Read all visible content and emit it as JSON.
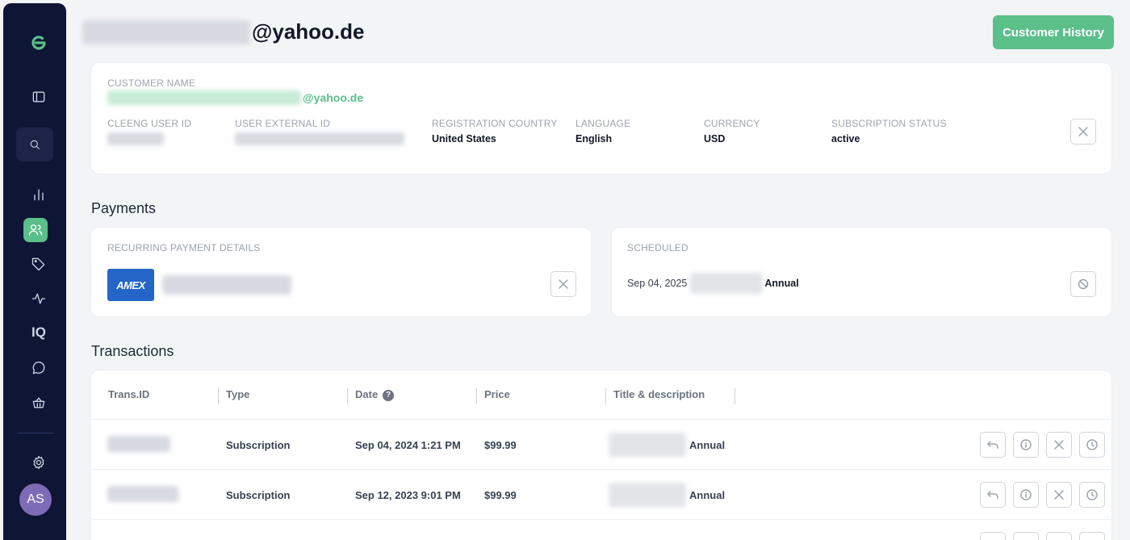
{
  "sidebar": {
    "logo": "green-e-logo",
    "items": [
      {
        "name": "panel-icon"
      },
      {
        "name": "search-icon"
      },
      {
        "name": "analytics-icon"
      },
      {
        "name": "customers-icon"
      },
      {
        "name": "tag-icon"
      },
      {
        "name": "activity-icon"
      },
      {
        "name": "iq-icon",
        "label": "IQ"
      },
      {
        "name": "chat-icon"
      },
      {
        "name": "basket-icon"
      },
      {
        "name": "settings-icon"
      }
    ],
    "avatar_initials": "AS"
  },
  "header": {
    "email_domain": "@yahoo.de",
    "history_button": "Customer History"
  },
  "customer": {
    "name_label": "CUSTOMER NAME",
    "name_domain": "@yahoo.de",
    "fields": [
      {
        "label": "CLEENG USER ID",
        "value": ""
      },
      {
        "label": "USER EXTERNAL ID",
        "value": ""
      },
      {
        "label": "REGISTRATION COUNTRY",
        "value": "United States"
      },
      {
        "label": "LANGUAGE",
        "value": "English"
      },
      {
        "label": "CURRENCY",
        "value": "USD"
      },
      {
        "label": "SUBSCRIPTION STATUS",
        "value": "active"
      }
    ]
  },
  "payments": {
    "title": "Payments",
    "recurring_label": "RECURRING PAYMENT DETAILS",
    "card_brand": "AMEX",
    "scheduled_label": "SCHEDULED",
    "scheduled_date": "Sep 04, 2025",
    "scheduled_plan": "Annual"
  },
  "transactions": {
    "title": "Transactions",
    "columns": [
      "Trans.ID",
      "Type",
      "Date",
      "Price",
      "Title & description"
    ],
    "rows": [
      {
        "type": "Subscription",
        "date": "Sep 04, 2024 1:21 PM",
        "price": "$99.99",
        "plan": "Annual"
      },
      {
        "type": "Subscription",
        "date": "Sep 12, 2023 9:01 PM",
        "price": "$99.99",
        "plan": "Annual"
      }
    ]
  },
  "colors": {
    "accent": "#5bbf8a",
    "sidebar": "#0f1535",
    "amex": "#2366c7"
  }
}
